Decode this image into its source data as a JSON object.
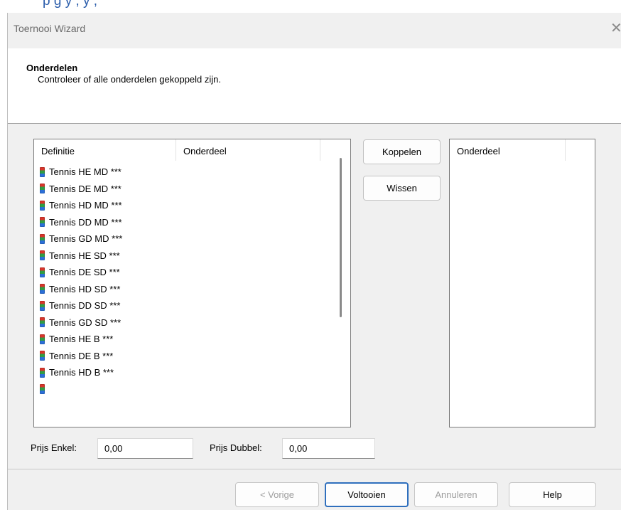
{
  "top_strip_text": "p                  g     y              ,                 y              ,",
  "window": {
    "title": "Toernooi Wizard",
    "close_glyph": "✕"
  },
  "header": {
    "title": "Onderdelen",
    "subtitle": "Controleer of alle onderdelen gekoppeld zijn."
  },
  "left_list": {
    "columns": [
      "Definitie",
      "Onderdeel"
    ],
    "rows": [
      "Tennis HE MD ***",
      "Tennis DE MD ***",
      "Tennis HD MD ***",
      "Tennis DD MD ***",
      "Tennis GD MD ***",
      "Tennis HE SD ***",
      "Tennis DE SD ***",
      "Tennis HD SD ***",
      "Tennis DD SD ***",
      "Tennis GD SD ***",
      "Tennis HE B ***",
      "Tennis DE B ***",
      "Tennis HD B ***"
    ],
    "row_icon": "database-icon"
  },
  "actions": {
    "link_label": "Koppelen",
    "clear_label": "Wissen"
  },
  "right_list": {
    "columns": [
      "Onderdeel"
    ]
  },
  "prices": {
    "single_label": "Prijs Enkel:",
    "single_value": "0,00",
    "double_label": "Prijs Dubbel:",
    "double_value": "0,00"
  },
  "footer": {
    "back_label": "< Vorige",
    "finish_label": "Voltooien",
    "cancel_label": "Annuleren",
    "help_label": "Help"
  },
  "colors": {
    "accent": "#2f6fbd",
    "window_bg": "#f0f0f0",
    "link_text": "#2a5caa"
  }
}
